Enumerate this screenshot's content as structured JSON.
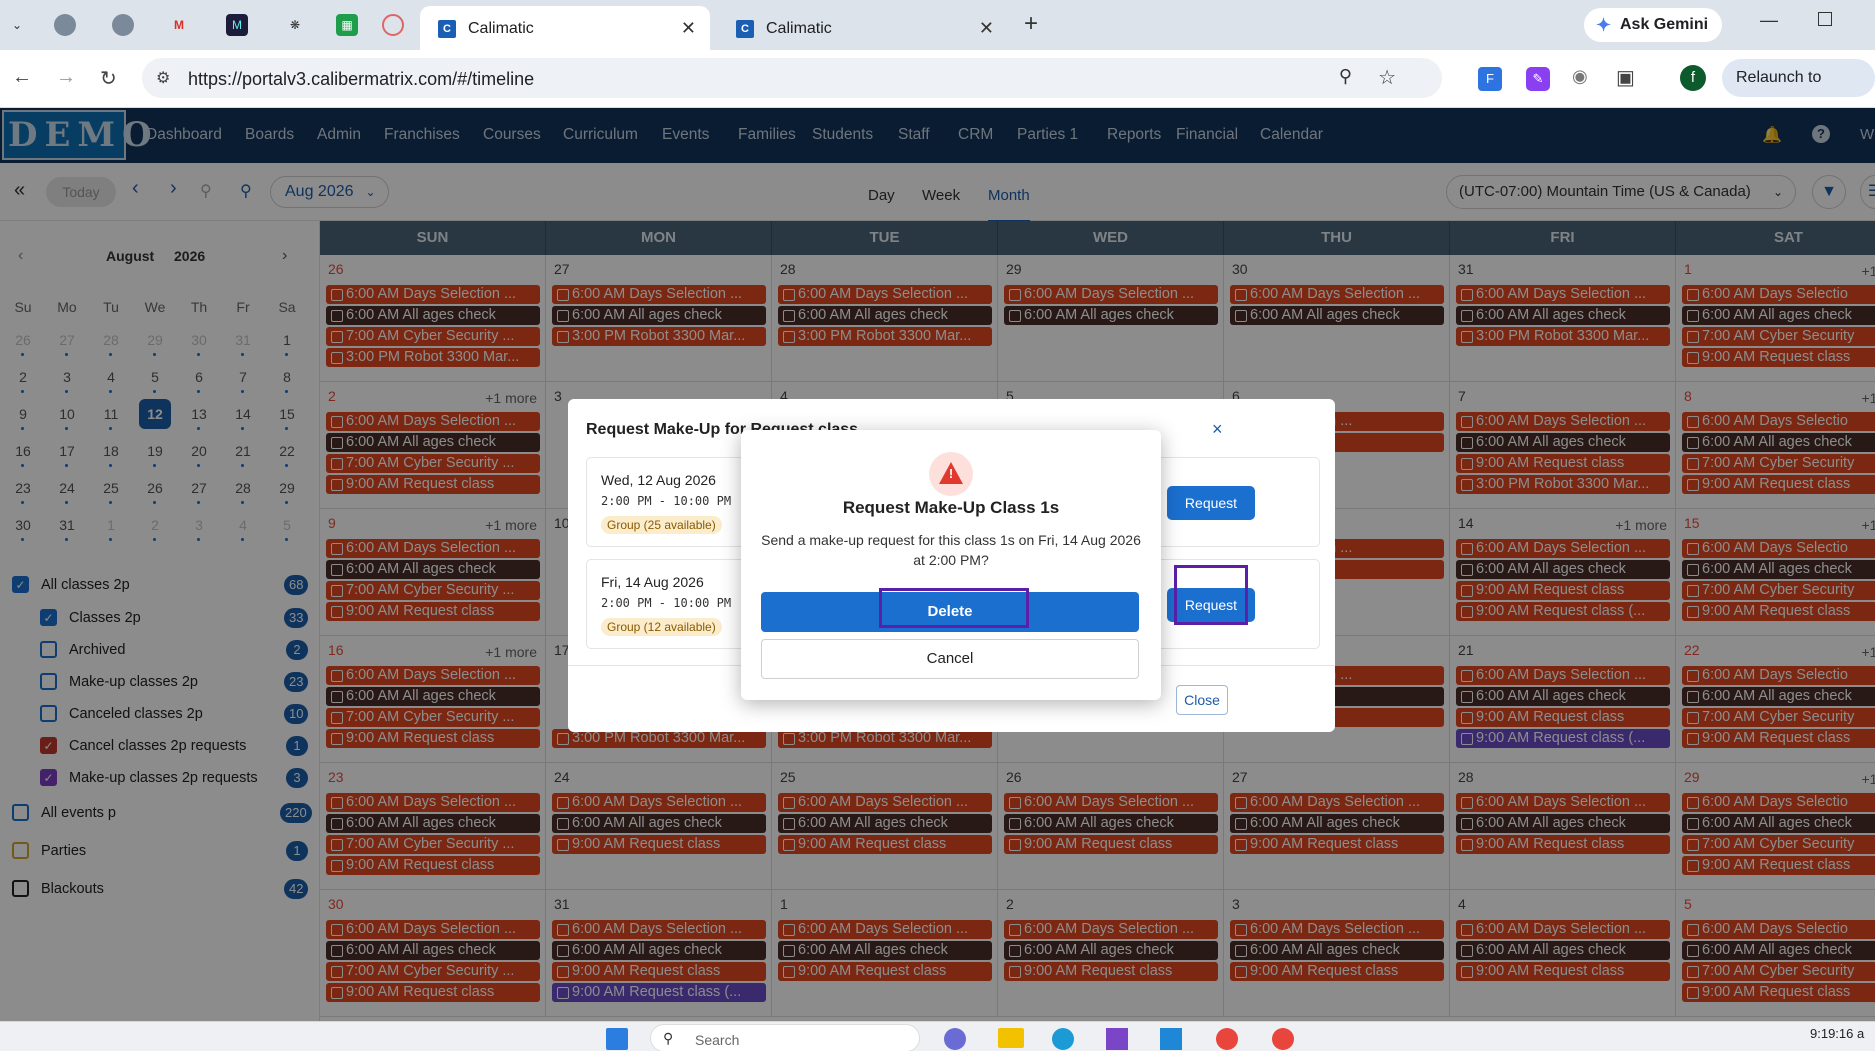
{
  "browser": {
    "tabs": [
      {
        "label": "Calimatic",
        "active": true
      },
      {
        "label": "Calimatic",
        "active": false
      }
    ],
    "new_tab": "+",
    "gemini": "Ask Gemini",
    "url": "https://portalv3.calibermatrix.com/#/timeline",
    "relaunch": "Relaunch to update",
    "profile_initial": "f"
  },
  "app": {
    "logo": "DEMO",
    "nav": [
      "Dashboard",
      "Boards",
      "Admin",
      "Franchises",
      "Courses",
      "Curriculum",
      "Events",
      "Families",
      "Students",
      "Staff",
      "CRM",
      "Parties 1",
      "Reports",
      "Financial",
      "Calendar"
    ],
    "nav_overflow": "W"
  },
  "toolbar": {
    "today": "Today",
    "month_select": "Aug 2026",
    "views": [
      "Day",
      "Week",
      "Month"
    ],
    "active_view": "Month",
    "timezone": "(UTC-07:00) Mountain Time (US & Canada)"
  },
  "mini_calendar": {
    "month": "August",
    "year": "2026",
    "weekdays": [
      "Su",
      "Mo",
      "Tu",
      "We",
      "Th",
      "Fr",
      "Sa"
    ],
    "weeks": [
      [
        "26",
        "27",
        "28",
        "29",
        "30",
        "31",
        "1"
      ],
      [
        "2",
        "3",
        "4",
        "5",
        "6",
        "7",
        "8"
      ],
      [
        "9",
        "10",
        "11",
        "12",
        "13",
        "14",
        "15"
      ],
      [
        "16",
        "17",
        "18",
        "19",
        "20",
        "21",
        "22"
      ],
      [
        "23",
        "24",
        "25",
        "26",
        "27",
        "28",
        "29"
      ],
      [
        "30",
        "31",
        "1",
        "2",
        "3",
        "4",
        "5"
      ]
    ],
    "selected": "12"
  },
  "filters": [
    {
      "label": "All classes 2p",
      "count": "68",
      "checked": true,
      "color": "#1b6fcf",
      "indent": false
    },
    {
      "label": "Classes 2p",
      "count": "33",
      "checked": true,
      "color": "#1b6fcf",
      "indent": true
    },
    {
      "label": "Archived",
      "count": "2",
      "checked": false,
      "color": "#1b6fcf",
      "indent": true
    },
    {
      "label": "Make-up classes 2p",
      "count": "23",
      "checked": false,
      "color": "#1b6fcf",
      "indent": true
    },
    {
      "label": "Canceled classes 2p",
      "count": "10",
      "checked": false,
      "color": "#1b6fcf",
      "indent": true
    },
    {
      "label": "Cancel classes 2p requests",
      "count": "1",
      "checked": true,
      "color": "#c0392b",
      "indent": true
    },
    {
      "label": "Make-up classes 2p requests",
      "count": "3",
      "checked": true,
      "color": "#7b3fc4",
      "indent": true
    },
    {
      "label": "All events p",
      "count": "220",
      "checked": false,
      "color": "#1b6fcf",
      "indent": false
    },
    {
      "label": "Parties",
      "count": "1",
      "checked": false,
      "color": "#d4a02a",
      "indent": false
    },
    {
      "label": "Blackouts",
      "count": "42",
      "checked": false,
      "color": "#222222",
      "indent": false
    }
  ],
  "calendar": {
    "day_headers": [
      "SUN",
      "MON",
      "TUE",
      "WED",
      "THU",
      "FRI",
      "SAT"
    ],
    "weeks": [
      {
        "dates": [
          "26",
          "27",
          "28",
          "29",
          "30",
          "31",
          "1"
        ],
        "more": [
          "",
          "",
          "",
          "",
          "",
          "",
          "+1 m"
        ],
        "events": [
          [
            "6:00 AM Days Selection ...",
            "6:00 AM All ages check",
            "7:00 AM Cyber Security ...",
            "3:00 PM Robot 3300 Mar..."
          ],
          [
            "6:00 AM Days Selection ...",
            "6:00 AM All ages check",
            "3:00 PM Robot 3300 Mar..."
          ],
          [
            "6:00 AM Days Selection ...",
            "6:00 AM All ages check",
            "3:00 PM Robot 3300 Mar..."
          ],
          [
            "6:00 AM Days Selection ...",
            "6:00 AM All ages check"
          ],
          [
            "6:00 AM Days Selection ...",
            "6:00 AM All ages check"
          ],
          [
            "6:00 AM Days Selection ...",
            "6:00 AM All ages check",
            "3:00 PM Robot 3300 Mar..."
          ],
          [
            "6:00 AM Days Selectio",
            "6:00 AM All ages check",
            "7:00 AM Cyber Security",
            "9:00 AM Request class"
          ]
        ]
      },
      {
        "dates": [
          "2",
          "3",
          "4",
          "5",
          "6",
          "7",
          "8"
        ],
        "more": [
          "+1 more",
          "",
          "",
          "",
          "",
          "",
          "+1 m"
        ],
        "events": [
          [
            "6:00 AM Days Selection ...",
            "6:00 AM All ages check",
            "7:00 AM Cyber Security ...",
            "9:00 AM Request class"
          ],
          [],
          [],
          [],
          [
            "ays Selection ...",
            "equest class"
          ],
          [
            "6:00 AM Days Selection ...",
            "6:00 AM All ages check",
            "9:00 AM Request class",
            "3:00 PM Robot 3300 Mar..."
          ],
          [
            "6:00 AM Days Selectio",
            "6:00 AM All ages check",
            "7:00 AM Cyber Security",
            "9:00 AM Request class"
          ]
        ]
      },
      {
        "dates": [
          "9",
          "10",
          "11",
          "12",
          "13",
          "14",
          "15"
        ],
        "more": [
          "+1 more",
          "",
          "",
          "",
          "",
          "+1 more",
          "+1 m"
        ],
        "events": [
          [
            "6:00 AM Days Selection ...",
            "6:00 AM All ages check",
            "7:00 AM Cyber Security ...",
            "9:00 AM Request class"
          ],
          [],
          [],
          [],
          [
            "ays Selection ...",
            "equest class"
          ],
          [
            "6:00 AM Days Selection ...",
            "6:00 AM All ages check",
            "9:00 AM Request class",
            "9:00 AM Request class (..."
          ],
          [
            "6:00 AM Days Selectio",
            "6:00 AM All ages check",
            "7:00 AM Cyber Security",
            "9:00 AM Request class"
          ]
        ]
      },
      {
        "dates": [
          "16",
          "17",
          "18",
          "19",
          "20",
          "21",
          "22"
        ],
        "more": [
          "+1 more",
          "",
          "",
          "",
          "",
          "",
          "+1 m"
        ],
        "events": [
          [
            "6:00 AM Days Selection ...",
            "6:00 AM All ages check",
            "7:00 AM Cyber Security ...",
            "9:00 AM Request class"
          ],
          [
            "",
            "",
            "",
            "3:00 PM Robot 3300 Mar..."
          ],
          [
            "",
            "",
            "",
            "3:00 PM Robot 3300 Mar..."
          ],
          [],
          [
            "ays Selection ...",
            "ll ages check",
            "equest class"
          ],
          [
            "6:00 AM Days Selection ...",
            "6:00 AM All ages check",
            "9:00 AM Request class",
            "9:00 AM Request class (..."
          ],
          [
            "6:00 AM Days Selectio",
            "6:00 AM All ages check",
            "7:00 AM Cyber Security",
            "9:00 AM Request class"
          ]
        ]
      },
      {
        "dates": [
          "23",
          "24",
          "25",
          "26",
          "27",
          "28",
          "29"
        ],
        "more": [
          "",
          "",
          "",
          "",
          "",
          "",
          "+1 m"
        ],
        "events": [
          [
            "6:00 AM Days Selection ...",
            "6:00 AM All ages check",
            "7:00 AM Cyber Security ...",
            "9:00 AM Request class"
          ],
          [
            "6:00 AM Days Selection ...",
            "6:00 AM All ages check",
            "9:00 AM Request class"
          ],
          [
            "6:00 AM Days Selection ...",
            "6:00 AM All ages check",
            "9:00 AM Request class"
          ],
          [
            "6:00 AM Days Selection ...",
            "6:00 AM All ages check",
            "9:00 AM Request class"
          ],
          [
            "6:00 AM Days Selection ...",
            "6:00 AM All ages check",
            "9:00 AM Request class"
          ],
          [
            "6:00 AM Days Selection ...",
            "6:00 AM All ages check",
            "9:00 AM Request class"
          ],
          [
            "6:00 AM Days Selectio",
            "6:00 AM All ages check",
            "7:00 AM Cyber Security",
            "9:00 AM Request class"
          ]
        ]
      },
      {
        "dates": [
          "30",
          "31",
          "1",
          "2",
          "3",
          "4",
          "5"
        ],
        "more": [
          "",
          "",
          "",
          "",
          "",
          "",
          ""
        ],
        "events": [
          [
            "6:00 AM Days Selection ...",
            "6:00 AM All ages check",
            "7:00 AM Cyber Security ...",
            "9:00 AM Request class"
          ],
          [
            "6:00 AM Days Selection ...",
            "6:00 AM All ages check",
            "9:00 AM Request class",
            "9:00 AM Request class (..."
          ],
          [
            "6:00 AM Days Selection ...",
            "6:00 AM All ages check",
            "9:00 AM Request class"
          ],
          [
            "6:00 AM Days Selection ...",
            "6:00 AM All ages check",
            "9:00 AM Request class"
          ],
          [
            "6:00 AM Days Selection ...",
            "6:00 AM All ages check",
            "9:00 AM Request class"
          ],
          [
            "6:00 AM Days Selection ...",
            "6:00 AM All ages check",
            "9:00 AM Request class"
          ],
          [
            "6:00 AM Days Selectio",
            "6:00 AM All ages check",
            "7:00 AM Cyber Security",
            "9:00 AM Request class"
          ]
        ]
      }
    ]
  },
  "bg_dialog": {
    "title": "Request Make-Up for Request class",
    "close_glyph": "×",
    "options": [
      {
        "date": "Wed, 12 Aug 2026",
        "time": "2:00 PM - 10:00 PM",
        "group": "Group (25 available)",
        "button": "Request"
      },
      {
        "date": "Fri, 14 Aug 2026",
        "time": "2:00 PM - 10:00 PM",
        "group": "Group (12 available)",
        "button": "Request"
      }
    ],
    "close_button": "Close"
  },
  "confirm_dialog": {
    "icon": "!",
    "title": "Request Make-Up Class 1s",
    "message": "Send a make-up request for this class 1s on Fri, 14 Aug 2026 at 2:00 PM?",
    "confirm": "Delete",
    "cancel": "Cancel"
  },
  "taskbar": {
    "search": "Search",
    "time": "9:19:16 a"
  },
  "colors": {
    "event_red": "#e24822",
    "event_dark": "#4a2f2a",
    "event_purple": "#6b4cc7",
    "primary": "#1b6fcf",
    "nav_bg": "#13345a",
    "highlight": "#5b1fa8"
  }
}
